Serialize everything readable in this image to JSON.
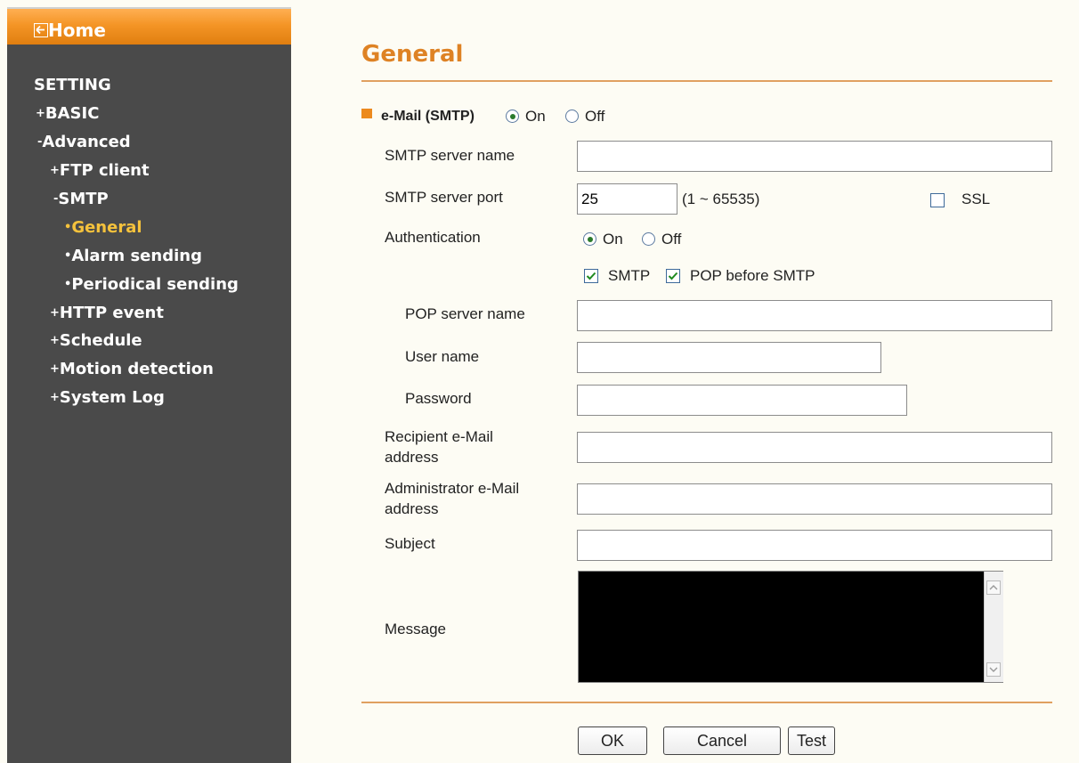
{
  "sidebar": {
    "home_label": "Home",
    "section_title": "SETTING",
    "items": [
      {
        "prefix": "+",
        "label": "BASIC"
      },
      {
        "prefix": "-",
        "label": "Advanced"
      },
      {
        "prefix": "+",
        "label": "FTP client"
      },
      {
        "prefix": "-",
        "label": "SMTP"
      },
      {
        "prefix": "•",
        "label": "General"
      },
      {
        "prefix": "•",
        "label": "Alarm sending"
      },
      {
        "prefix": "•",
        "label": "Periodical sending"
      },
      {
        "prefix": "+",
        "label": "HTTP event"
      },
      {
        "prefix": "+",
        "label": "Schedule"
      },
      {
        "prefix": "+",
        "label": "Motion detection"
      },
      {
        "prefix": "+",
        "label": "System Log"
      }
    ],
    "active_item": "General"
  },
  "content": {
    "title": "General",
    "email_smtp": {
      "label": "e-Mail (SMTP)",
      "on_label": "On",
      "off_label": "Off",
      "selected": "On"
    },
    "smtp_server_name": {
      "label": "SMTP server name",
      "value": ""
    },
    "smtp_server_port": {
      "label": "SMTP server port",
      "value": "25",
      "range": "(1 ~ 65535)"
    },
    "ssl": {
      "label": "SSL",
      "checked": false
    },
    "authentication": {
      "label": "Authentication",
      "on_label": "On",
      "off_label": "Off",
      "selected": "On"
    },
    "auth_smtp": {
      "label": "SMTP",
      "checked": true
    },
    "auth_pop": {
      "label": "POP before SMTP",
      "checked": true
    },
    "pop_server_name": {
      "label": "POP server name",
      "value": ""
    },
    "user_name": {
      "label": "User name",
      "value": ""
    },
    "password": {
      "label": "Password",
      "value": ""
    },
    "recipient": {
      "label_line1": "Recipient e-Mail",
      "label_line2": "address",
      "value": ""
    },
    "administrator": {
      "label_line1": "Administrator e-Mail",
      "label_line2": "address",
      "value": ""
    },
    "subject": {
      "label": "Subject",
      "value": ""
    },
    "message": {
      "label": "Message",
      "value": ""
    }
  },
  "buttons": {
    "ok": "OK",
    "cancel": "Cancel",
    "test": "Test"
  },
  "colors": {
    "accent": "#de8224",
    "sidebar_bg": "#4a4a4a",
    "active_nav": "#f5c23c"
  }
}
